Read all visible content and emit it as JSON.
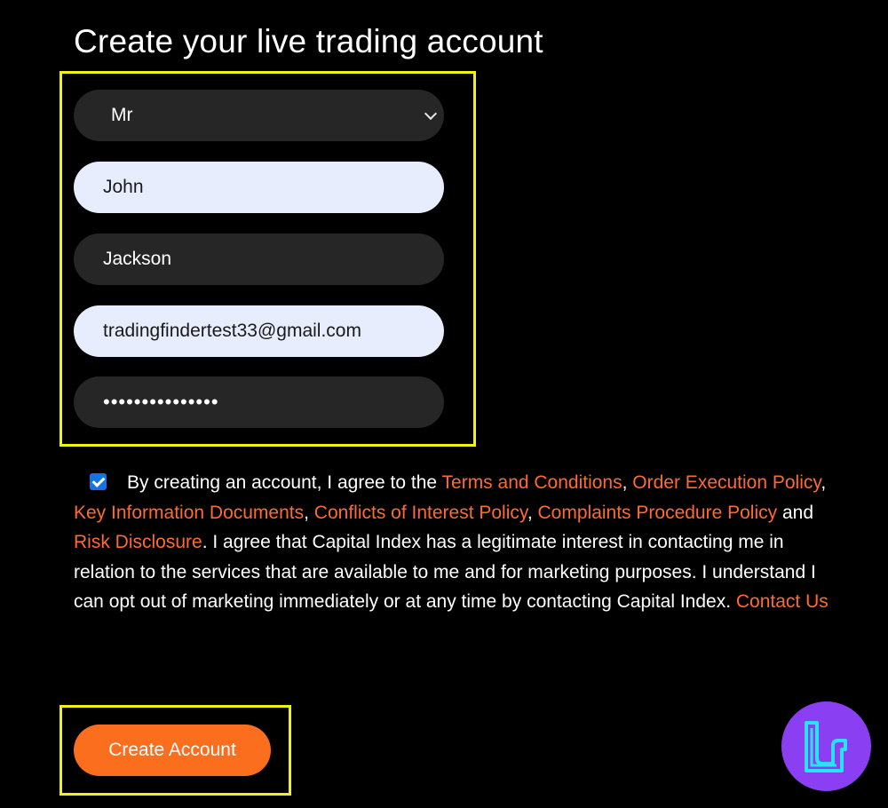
{
  "page": {
    "title": "Create your live trading account"
  },
  "form": {
    "title_select": {
      "value": "Mr"
    },
    "first_name": {
      "value": "John"
    },
    "last_name": {
      "value": "Jackson"
    },
    "email": {
      "value": "tradingfindertest33@gmail.com"
    },
    "password": {
      "value": "•••••••••••••••"
    }
  },
  "consent": {
    "checked": true,
    "text_1": "By creating an account, I agree to the ",
    "link_terms": "Terms and Conditions",
    "sep_1": ", ",
    "link_order": "Order Execution Policy",
    "sep_2": ", ",
    "link_kid": "Key Information Documents",
    "sep_3": ", ",
    "link_conflicts": "Conflicts of Interest Policy",
    "sep_4": ", ",
    "link_complaints": "Complaints Procedure Policy",
    "text_and": " and ",
    "link_risk": "Risk Disclosure",
    "text_2": ". I agree that Capital Index has a legitimate interest in contacting me in relation to the services that are available to me and for marketing purposes. I understand I can opt out of marketing immediately or at any time by contacting Capital Index. ",
    "link_contact": "Contact Us"
  },
  "actions": {
    "create_account_label": "Create Account"
  },
  "colors": {
    "background": "#000000",
    "highlight": "#f2f20f",
    "link": "#ff6b2c",
    "button": "#fb6e1e",
    "checkbox": "#1473e6",
    "logo_bg": "#8b3ff2",
    "logo_stroke": "#27e3f5"
  },
  "logo": {
    "icon": "brand-logo-icon"
  }
}
